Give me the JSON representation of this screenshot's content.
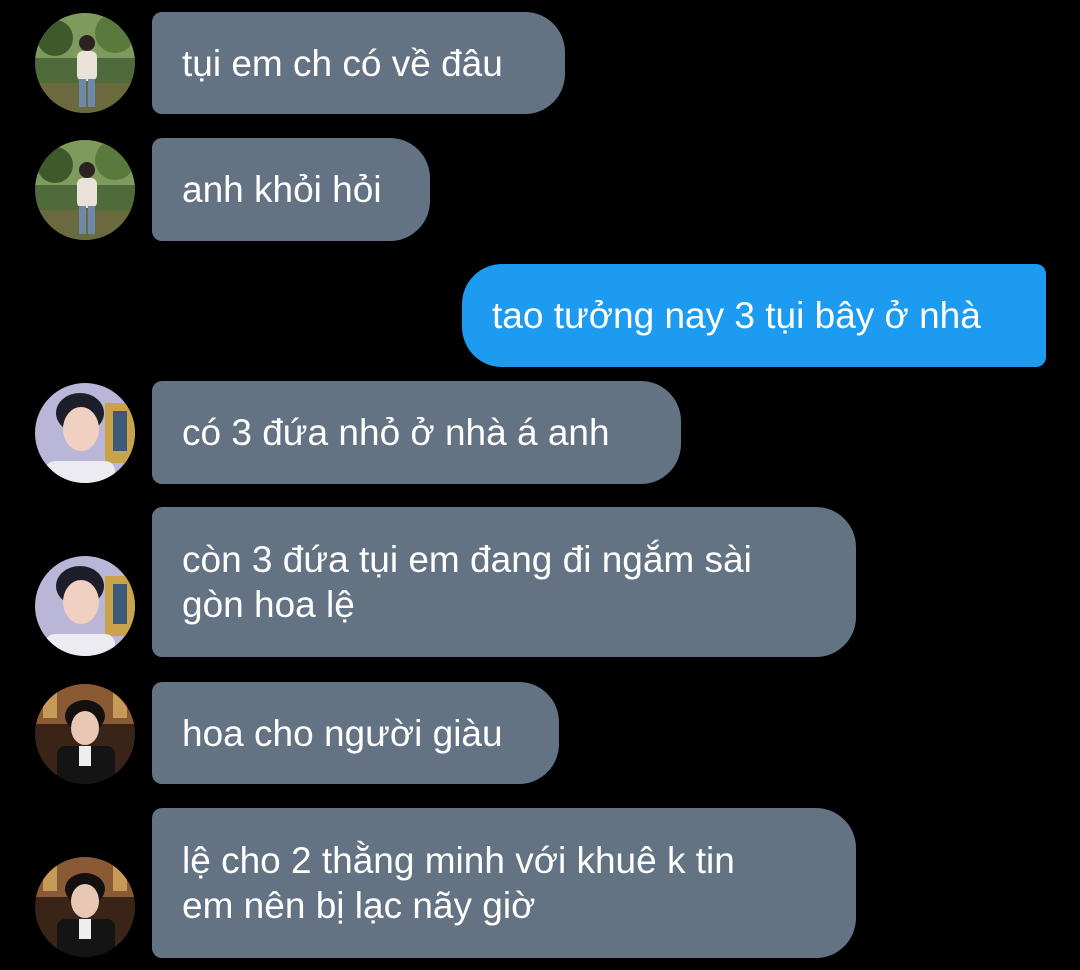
{
  "messages": [
    {
      "sender": "contact_a",
      "text": "tụi em ch có về đâu"
    },
    {
      "sender": "contact_a",
      "text": "anh khỏi hỏi"
    },
    {
      "sender": "self",
      "text": "tao tưởng nay 3 tụi bây ở nhà"
    },
    {
      "sender": "contact_b",
      "text": "có 3 đứa nhỏ ở nhà á anh"
    },
    {
      "sender": "contact_b",
      "text": "còn 3 đứa tụi em đang đi ngắm sài gòn hoa lệ",
      "lines": [
        "còn 3 đứa tụi em đang đi ngắm sài",
        "gòn hoa lệ"
      ]
    },
    {
      "sender": "contact_c",
      "text": "hoa cho người giàu"
    },
    {
      "sender": "contact_c",
      "text": "lệ cho 2 thằng minh với khuê k tin em nên bị lạc nãy giờ",
      "lines": [
        "lệ cho 2 thằng minh với khuê k tin",
        "em nên bị lạc nãy giờ"
      ]
    }
  ],
  "colors": {
    "background": "#000000",
    "incoming_bubble": "#637383",
    "outgoing_bubble": "#1d9bf0",
    "text": "#ffffff"
  },
  "icons": {
    "contact_a": "avatar-photo-forest",
    "contact_b": "avatar-photo-smiling",
    "contact_c": "avatar-photo-restaurant"
  }
}
